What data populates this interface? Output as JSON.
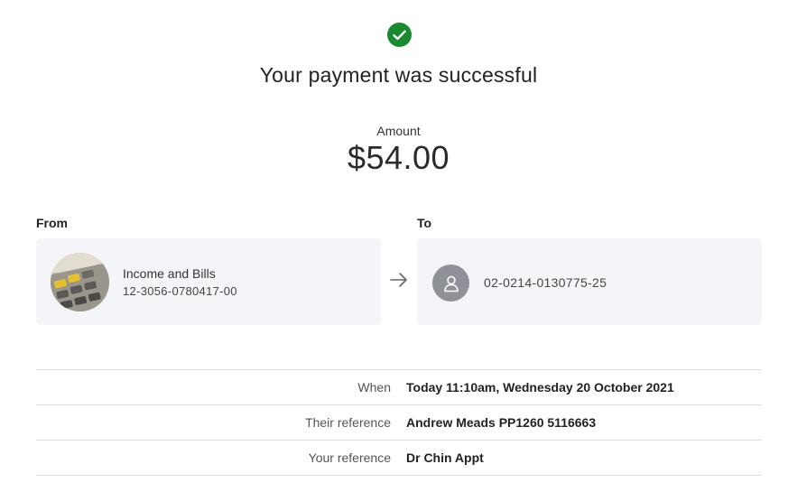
{
  "status": {
    "icon": "check-circle-icon",
    "title": "Your payment was successful",
    "color": "#1a8a2e"
  },
  "amount": {
    "label": "Amount",
    "value": "$54.00"
  },
  "from": {
    "heading": "From",
    "account_name": "Income and Bills",
    "account_number": "12-3056-0780417-00",
    "image": "calculator-photo"
  },
  "transfer_icon": "arrow-right-icon",
  "to": {
    "heading": "To",
    "avatar_icon": "person-icon",
    "account_number": "02-0214-0130775-25"
  },
  "details": [
    {
      "label": "When",
      "value": "Today 11:10am, Wednesday 20 October 2021"
    },
    {
      "label": "Their reference",
      "value": "Andrew Meads PP1260 5116663"
    },
    {
      "label": "Your reference",
      "value": "Dr Chin Appt"
    }
  ]
}
